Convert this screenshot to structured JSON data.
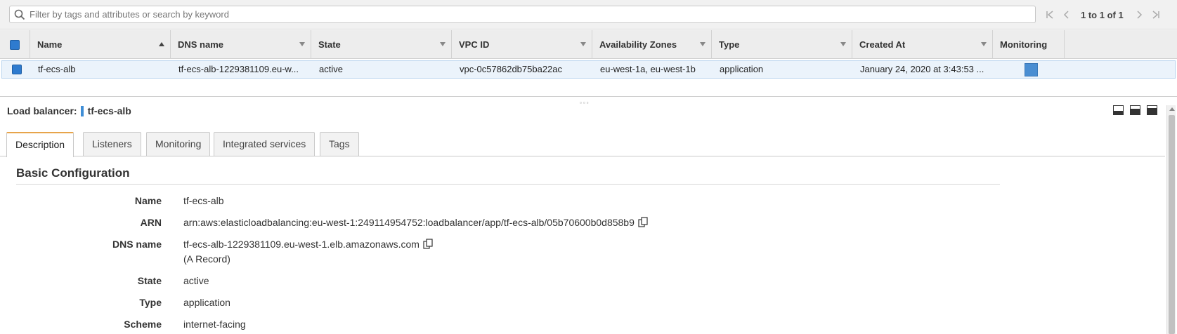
{
  "search": {
    "placeholder": "Filter by tags and attributes or search by keyword",
    "icon": "search-icon"
  },
  "pager": {
    "text": "1 to 1 of 1"
  },
  "grid": {
    "columns": [
      "Name",
      "DNS name",
      "State",
      "VPC ID",
      "Availability Zones",
      "Type",
      "Created At",
      "Monitoring"
    ],
    "sorted_column": "Name",
    "sort_direction": "ascending",
    "rows": [
      {
        "selected": true,
        "name": "tf-ecs-alb",
        "dns_name": "tf-ecs-alb-1229381109.eu-w...",
        "state": "active",
        "vpc_id": "vpc-0c57862db75ba22ac",
        "availability_zones": "eu-west-1a, eu-west-1b",
        "type": "application",
        "created_at": "January 24, 2020 at 3:43:53 ..."
      }
    ]
  },
  "detail": {
    "title_prefix": "Load balancer:",
    "title_name": "tf-ecs-alb",
    "tabs": [
      "Description",
      "Listeners",
      "Monitoring",
      "Integrated services",
      "Tags"
    ],
    "active_tab": "Description",
    "section_title": "Basic Configuration",
    "properties": {
      "name_label": "Name",
      "name_value": "tf-ecs-alb",
      "arn_label": "ARN",
      "arn_value": "arn:aws:elasticloadbalancing:eu-west-1:249114954752:loadbalancer/app/tf-ecs-alb/05b70600b0d858b9",
      "dns_label": "DNS name",
      "dns_value": "tf-ecs-alb-1229381109.eu-west-1.elb.amazonaws.com",
      "dns_record": "(A Record)",
      "state_label": "State",
      "state_value": "active",
      "type_label": "Type",
      "type_value": "application",
      "scheme_label": "Scheme",
      "scheme_value": "internet-facing"
    }
  },
  "colors": {
    "accent_blue": "#2e7bcf",
    "selected_row": "#ebf3fb",
    "active_tab_border": "#e7a44b"
  }
}
